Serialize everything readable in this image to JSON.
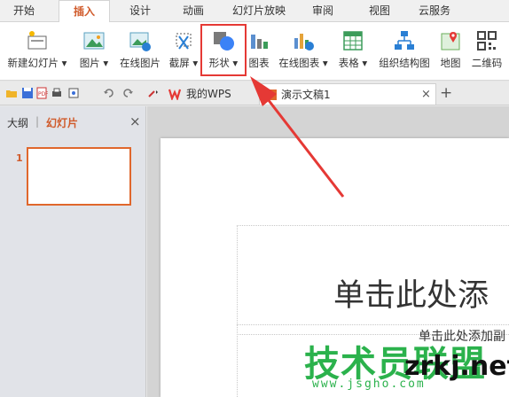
{
  "menu": {
    "tabs": [
      {
        "label": "开始"
      },
      {
        "label": "插入"
      },
      {
        "label": "设计"
      },
      {
        "label": "动画"
      },
      {
        "label": "幻灯片放映"
      },
      {
        "label": "审阅"
      },
      {
        "label": "视图"
      },
      {
        "label": "云服务"
      }
    ],
    "active_index": 1
  },
  "ribbon": {
    "buttons": [
      {
        "label": "新建幻灯片 ▾",
        "icon": "new-slide-icon"
      },
      {
        "label": "图片 ▾",
        "icon": "picture-icon"
      },
      {
        "label": "在线图片",
        "icon": "online-picture-icon"
      },
      {
        "label": "截屏 ▾",
        "icon": "screenshot-icon"
      },
      {
        "label": "形状 ▾",
        "icon": "shapes-icon"
      },
      {
        "label": "图表",
        "icon": "chart-icon"
      },
      {
        "label": "在线图表 ▾",
        "icon": "online-chart-icon"
      },
      {
        "label": "表格 ▾",
        "icon": "table-icon"
      },
      {
        "label": "组织结构图",
        "icon": "org-chart-icon"
      },
      {
        "label": "地图",
        "icon": "map-icon"
      },
      {
        "label": "二维码",
        "icon": "qrcode-icon"
      }
    ],
    "highlighted": "形状"
  },
  "quickbar": {
    "tabs": [
      {
        "label": "我的WPS"
      },
      {
        "label": "演示文稿1"
      }
    ],
    "close_glyph": "×",
    "new_tab_glyph": "+"
  },
  "leftpanel": {
    "tab_outline": "大纲",
    "tab_slides": "幻灯片",
    "close_glyph": "×",
    "slide_number": "1"
  },
  "slide": {
    "title_placeholder": "单击此处添",
    "subtitle_placeholder": "单击此处添加副"
  },
  "watermark": {
    "cn": "技术员联盟",
    "en": "zrkj.net",
    "url": "www.jsgho.com"
  },
  "colors": {
    "accent": "#d05a2a",
    "highlight": "#e53935",
    "watermark_green": "#2bb24c"
  }
}
